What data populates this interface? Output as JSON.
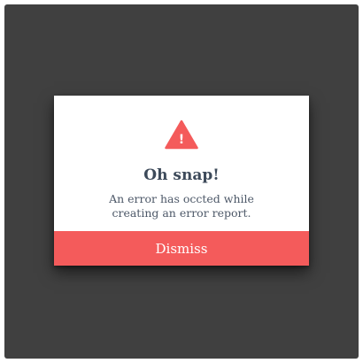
{
  "dialog": {
    "icon": "warning-triangle-icon",
    "icon_glyph": "!",
    "title": "Oh snap!",
    "message_line1": "An error has occted while",
    "message_line2": "creating an error report.",
    "dismiss_label": "Dismiss"
  },
  "colors": {
    "backdrop": "#404040",
    "dialog_bg": "#ffffff",
    "accent": "#f45b5b",
    "title_text": "#3d4a5a",
    "body_text": "#4d5868"
  }
}
